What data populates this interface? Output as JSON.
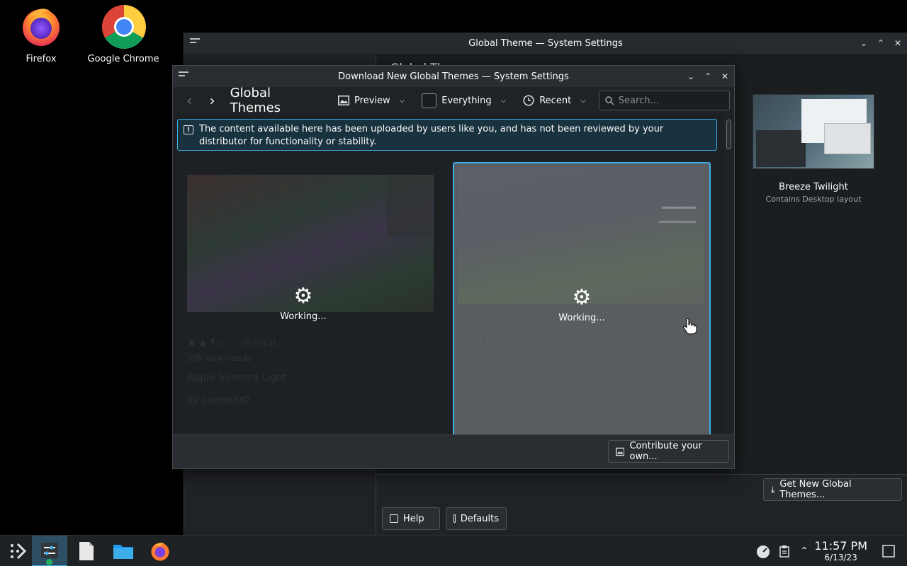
{
  "desktop": {
    "icons": [
      {
        "label": "Firefox"
      },
      {
        "label": "Google Chrome"
      }
    ]
  },
  "bg_window": {
    "title": "Global Theme — System Settings",
    "header_partial": "Global Th",
    "card": {
      "name": "Breeze Twilight",
      "subtitle": "Contains Desktop layout"
    },
    "get_new_label": "Get New Global Themes...",
    "help_label": "Help",
    "defaults_label": "Defaults"
  },
  "dialog": {
    "title": "Download New Global Themes — System Settings",
    "heading": "Global Themes",
    "preview_label": "Preview",
    "filter_label": "Everything",
    "sort_label": "Recent",
    "search_placeholder": "Search...",
    "banner": "The content available here has been uploaded by users like you, and has not been reviewed by your distributor for functionality or stability.",
    "contribute_label": "Contribute your own...",
    "items": [
      {
        "name": "Apple Sonoma Light",
        "rating": "(5.5/10)",
        "downloads": "30k downloads",
        "author": "By zayronXIO",
        "status": "Working..."
      },
      {
        "name": "Apple Sonoma Dark",
        "rating": "(5.5/10)",
        "downloads": "8k downloads",
        "author": "By zayronXIO",
        "status": "Working..."
      }
    ]
  },
  "taskbar": {
    "time": "11:57 PM",
    "date": "6/13/23"
  },
  "colors": {
    "accent": "#3daee9",
    "window_bg": "#202326",
    "panel_bg": "#1f2224"
  }
}
